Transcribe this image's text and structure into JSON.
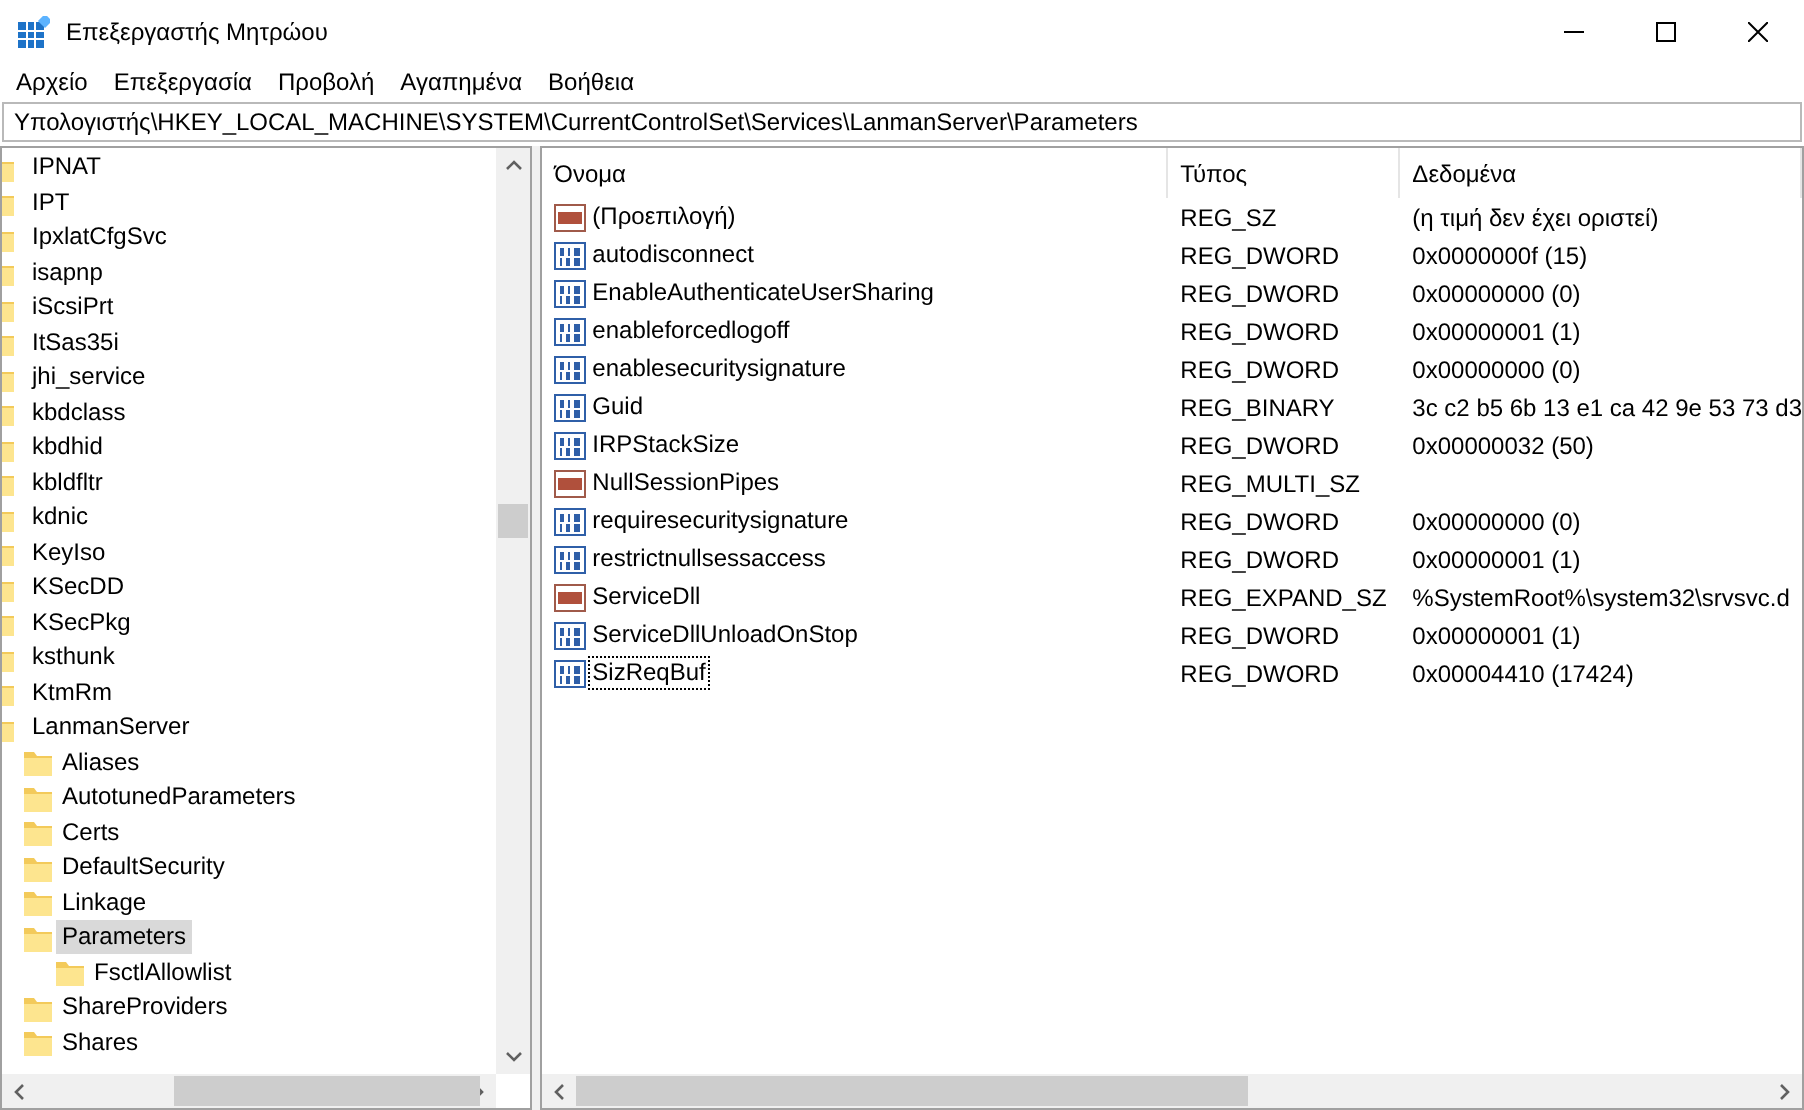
{
  "window": {
    "title": "Επεξεργαστής Μητρώου"
  },
  "menu": [
    "Αρχείο",
    "Επεξεργασία",
    "Προβολή",
    "Αγαπημένα",
    "Βοήθεια"
  ],
  "address": "Υπολογιστής\\HKEY_LOCAL_MACHINE\\SYSTEM\\CurrentControlSet\\Services\\LanmanServer\\Parameters",
  "tree": [
    {
      "label": "IPNAT",
      "selected": false
    },
    {
      "label": "IPT",
      "selected": false
    },
    {
      "label": "IpxlatCfgSvc",
      "selected": false
    },
    {
      "label": "isapnp",
      "selected": false
    },
    {
      "label": "iScsiPrt",
      "selected": false
    },
    {
      "label": "ItSas35i",
      "selected": false
    },
    {
      "label": "jhi_service",
      "selected": false
    },
    {
      "label": "kbdclass",
      "selected": false
    },
    {
      "label": "kbdhid",
      "selected": false
    },
    {
      "label": "kbldfltr",
      "selected": false
    },
    {
      "label": "kdnic",
      "selected": false
    },
    {
      "label": "KeyIso",
      "selected": false
    },
    {
      "label": "KSecDD",
      "selected": false
    },
    {
      "label": "KSecPkg",
      "selected": false
    },
    {
      "label": "ksthunk",
      "selected": false
    },
    {
      "label": "KtmRm",
      "selected": false
    },
    {
      "label": "LanmanServer",
      "selected": false,
      "children": [
        {
          "label": "Aliases",
          "selected": false
        },
        {
          "label": "AutotunedParameters",
          "selected": false
        },
        {
          "label": "Certs",
          "selected": false
        },
        {
          "label": "DefaultSecurity",
          "selected": false
        },
        {
          "label": "Linkage",
          "selected": false
        },
        {
          "label": "Parameters",
          "selected": true,
          "children": [
            {
              "label": "FsctlAllowlist",
              "selected": false
            }
          ]
        },
        {
          "label": "ShareProviders",
          "selected": false
        },
        {
          "label": "Shares",
          "selected": false
        }
      ]
    }
  ],
  "table": {
    "columns": [
      "Όνομα",
      "Τύπος",
      "Δεδομένα"
    ],
    "rows": [
      {
        "kind": "string",
        "name": "(Προεπιλογή)",
        "type": "REG_SZ",
        "data": "(η τιμή δεν έχει οριστεί)",
        "focused": false
      },
      {
        "kind": "binary",
        "name": "autodisconnect",
        "type": "REG_DWORD",
        "data": "0x0000000f (15)",
        "focused": false
      },
      {
        "kind": "binary",
        "name": "EnableAuthenticateUserSharing",
        "type": "REG_DWORD",
        "data": "0x00000000 (0)",
        "focused": false
      },
      {
        "kind": "binary",
        "name": "enableforcedlogoff",
        "type": "REG_DWORD",
        "data": "0x00000001 (1)",
        "focused": false
      },
      {
        "kind": "binary",
        "name": "enablesecuritysignature",
        "type": "REG_DWORD",
        "data": "0x00000000 (0)",
        "focused": false
      },
      {
        "kind": "binary",
        "name": "Guid",
        "type": "REG_BINARY",
        "data": "3c c2 b5 6b 13 e1 ca 42 9e 53 73 d3",
        "focused": false
      },
      {
        "kind": "binary",
        "name": "IRPStackSize",
        "type": "REG_DWORD",
        "data": "0x00000032 (50)",
        "focused": false
      },
      {
        "kind": "string",
        "name": "NullSessionPipes",
        "type": "REG_MULTI_SZ",
        "focused": false
      },
      {
        "kind": "binary",
        "name": "requiresecuritysignature",
        "type": "REG_DWORD",
        "data": "0x00000000 (0)",
        "focused": false
      },
      {
        "kind": "binary",
        "name": "restrictnullsessaccess",
        "type": "REG_DWORD",
        "data": "0x00000001 (1)",
        "focused": false
      },
      {
        "kind": "string",
        "name": "ServiceDll",
        "type": "REG_EXPAND_SZ",
        "data": "%SystemRoot%\\system32\\srvsvc.d",
        "focused": false
      },
      {
        "kind": "binary",
        "name": "ServiceDllUnloadOnStop",
        "type": "REG_DWORD",
        "data": "0x00000001 (1)",
        "focused": false
      },
      {
        "kind": "binary",
        "name": "SizReqBuf",
        "type": "REG_DWORD",
        "data": "0x00004410 (17424)",
        "focused": true
      }
    ]
  }
}
